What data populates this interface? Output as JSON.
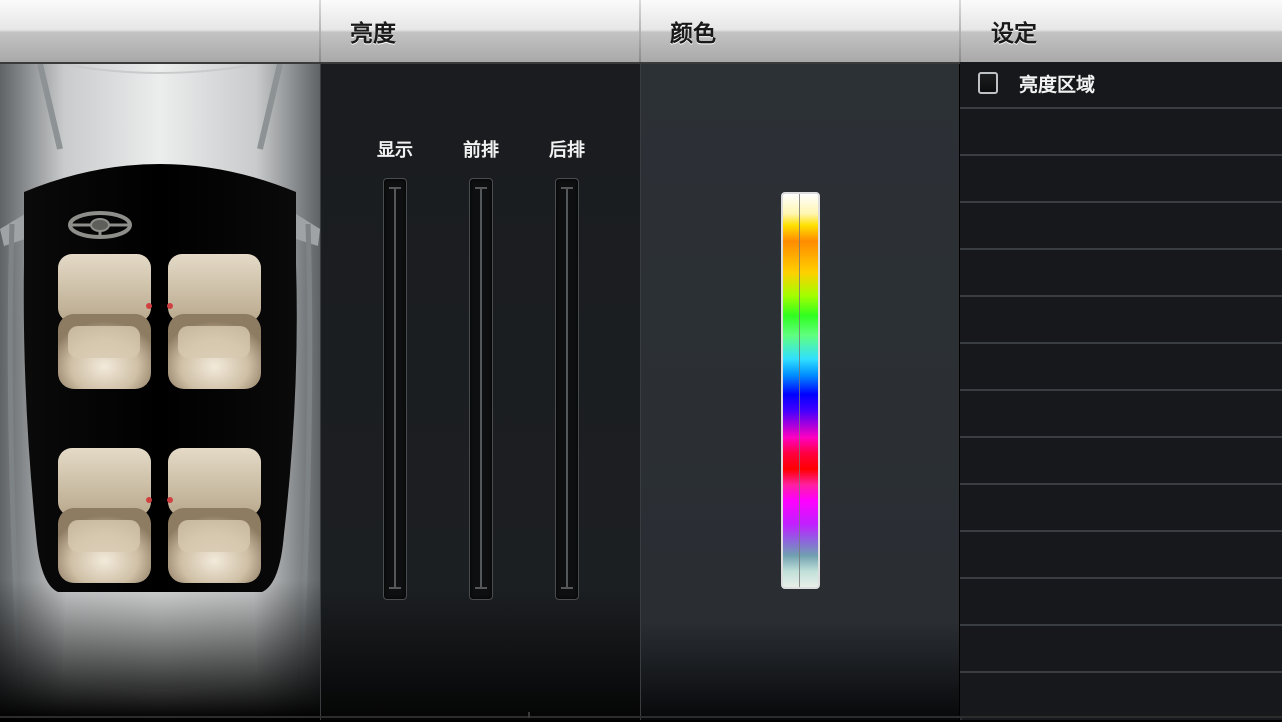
{
  "header": {
    "tabs": [
      {
        "label": "亮度"
      },
      {
        "label": "颜色"
      },
      {
        "label": "设定"
      }
    ]
  },
  "brightness": {
    "sliders": [
      {
        "label": "显示"
      },
      {
        "label": "前排"
      },
      {
        "label": "后排"
      }
    ]
  },
  "settings": {
    "items": [
      {
        "label": "亮度区域",
        "checked": false
      }
    ]
  },
  "colors": {
    "seat": "#d9ccb4",
    "car_body": "#e5e6e6",
    "cabin": "#050505",
    "panel_dark": "#1b1d20",
    "panel_color": "#2b3035"
  }
}
